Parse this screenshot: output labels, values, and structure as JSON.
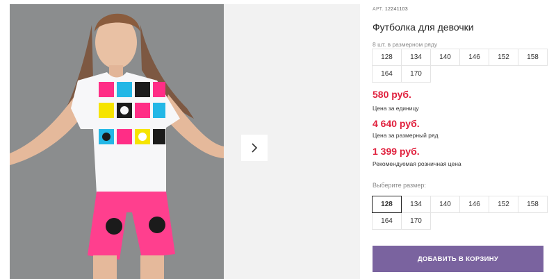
{
  "product": {
    "art_label": "АРТ.",
    "art_number": "12241103",
    "title": "Футболка для девочки",
    "image_icon": "product-photo-girl-mickey-tshirt"
  },
  "pack": {
    "note": "8 шт. в размерном ряду",
    "sizes": [
      "128",
      "134",
      "140",
      "146",
      "152",
      "158",
      "164",
      "170"
    ]
  },
  "prices": [
    {
      "value": "580 руб.",
      "label": "Цена за единицу"
    },
    {
      "value": "4 640 руб.",
      "label": "Цена за размерный ряд"
    },
    {
      "value": "1 399 руб.",
      "label": "Рекомендуемая розничная цена"
    }
  ],
  "size_picker": {
    "label": "Выберите размер:",
    "sizes": [
      "128",
      "134",
      "140",
      "146",
      "152",
      "158",
      "164",
      "170"
    ],
    "selected": "128"
  },
  "cart": {
    "add_label": "ДОБАВИТЬ В КОРЗИНУ"
  },
  "colors": {
    "price": "#e0203d",
    "button": "#7a639f",
    "photo_bg": "#8c8e8f"
  },
  "icons": {
    "next": "chevron-right-icon"
  }
}
